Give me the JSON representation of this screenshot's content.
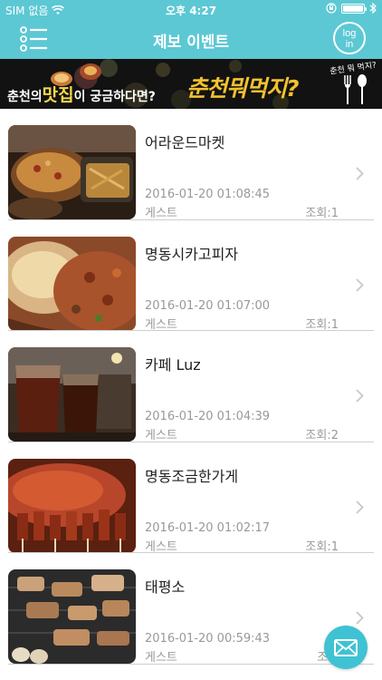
{
  "status_bar": {
    "carrier": "SIM 없음",
    "time": "오후 4:27",
    "battery_level": 1.0
  },
  "nav": {
    "title": "제보 이벤트",
    "menu_icon": "list-menu-icon",
    "login_label_1": "log",
    "login_label_2": "in"
  },
  "banner": {
    "prefix": "춘천의",
    "accent": "맛집",
    "middle": "이 궁금하다면?",
    "brand": "춘천뭐먹지?",
    "script": "춘천 뭐 먹지?"
  },
  "items": [
    {
      "title": "어라운드마켓",
      "date": "2016-01-20 01:08:45",
      "author": "게스트",
      "views": "조회:1"
    },
    {
      "title": "명동시카고피자",
      "date": "2016-01-20 01:07:00",
      "author": "게스트",
      "views": "조회:1"
    },
    {
      "title": "카페 Luz",
      "date": "2016-01-20 01:04:39",
      "author": "게스트",
      "views": "조회:2"
    },
    {
      "title": "명동조금한가게",
      "date": "2016-01-20 01:02:17",
      "author": "게스트",
      "views": "조회:1"
    },
    {
      "title": "태평소",
      "date": "2016-01-20 00:59:43",
      "author": "게스트",
      "views": "조회"
    }
  ],
  "colors": {
    "accent": "#5cc8d4",
    "fab": "#3fc2d3"
  },
  "fab_icon": "mail-icon"
}
